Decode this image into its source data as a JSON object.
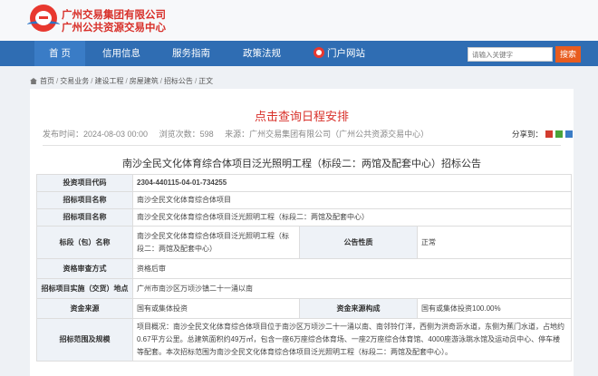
{
  "header": {
    "org_name_1": "广州交易集团有限公司",
    "org_name_2": "广州公共资源交易中心"
  },
  "nav": {
    "items": [
      "首 页",
      "信用信息",
      "服务指南",
      "政策法规"
    ],
    "portal": "门户网站",
    "search_placeholder": "请输入关键字",
    "search_button": "搜索"
  },
  "breadcrumb": [
    "首页",
    "交易业务",
    "建设工程",
    "房屋建筑",
    "招标公告",
    "正文"
  ],
  "article": {
    "title": "点击查询日程安排",
    "publish_time": "发布时间：2024-08-03 00:00",
    "views": "浏览次数：598",
    "source": "来源：广州交易集团有限公司（广州公共资源交易中心）",
    "share_label": "分享到：",
    "subtitle": "南沙全民文化体育综合体项目泛光照明工程（标段二：两馆及配套中心）招标公告"
  },
  "table": {
    "project_code_label": "投资项目代码",
    "project_code": "2304-440115-04-01-734255",
    "project_name_label": "招标项目名称",
    "project_name": "南沙全民文化体育综合体项目",
    "tender_name_label": "招标项目名称",
    "tender_name": "南沙全民文化体育综合体项目泛光照明工程（标段二：两馆及配套中心）",
    "section_label": "标段（包）名称",
    "section_name": "南沙全民文化体育综合体项目泛光照明工程（标段二：两馆及配套中心）",
    "notice_nature_label": "公告性质",
    "notice_nature": "正常",
    "review_label": "资格审查方式",
    "review_value": "资格后审",
    "location_label": "招标项目实施（交货）地点",
    "location": "广州市南沙区万顷沙镇二十一涌以南",
    "fund_source_label": "资金来源",
    "fund_source": "国有或集体投资",
    "fund_structure_label": "资金来源构成",
    "fund_structure": "国有或集体投资100.00%",
    "scope_label": "招标范围及规模",
    "scope_text": "项目概况：南沙全民文化体育综合体项目位于南沙区万顷沙二十一涌以南、南邻铃仃洋，西侧为洪奇沥水道，东侧为蕉门水道，占地约0.67平方公里。总建筑面积约49万㎡，包含一座6万座综合体育场、一座2万座综合体育馆、4000座游泳跳水馆及运动员中心、停车楼等配套。本次招标范围为南沙全民文化体育综合体项目泛光照明工程（标段二：两馆及配套中心）。"
  }
}
